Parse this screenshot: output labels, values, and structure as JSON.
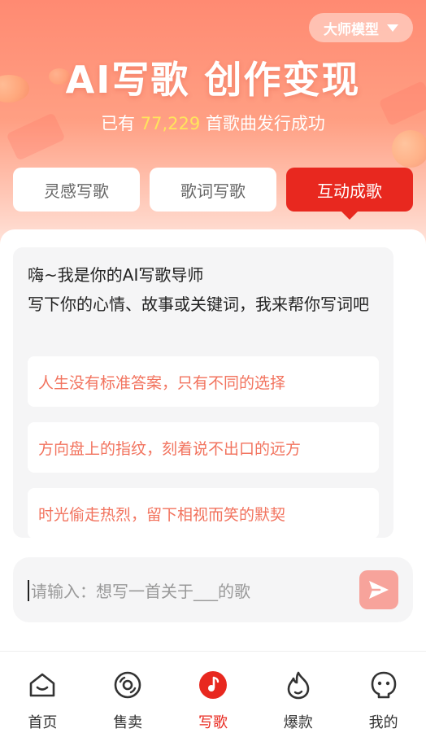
{
  "header": {
    "model_selector": "大师模型",
    "title": "AI写歌 创作变现",
    "subtitle_prefix": "已有",
    "subtitle_count": "77,229",
    "subtitle_suffix": "首歌曲发行成功"
  },
  "tabs": [
    {
      "label": "灵感写歌",
      "active": false
    },
    {
      "label": "歌词写歌",
      "active": false
    },
    {
      "label": "互动成歌",
      "active": true
    }
  ],
  "chat": {
    "greeting_line1": "嗨~我是你的AI写歌导师",
    "greeting_line2": "写下你的心情、故事或关键词，我来帮你写词吧",
    "suggestions": [
      "人生没有标准答案，只有不同的选择",
      "方向盘上的指纹，刻着说不出口的远方",
      "时光偷走热烈，留下相视而笑的默契"
    ]
  },
  "input": {
    "placeholder": "请输入：想写一首关于___的歌",
    "value": ""
  },
  "nav": [
    {
      "label": "首页",
      "icon": "home-icon",
      "active": false
    },
    {
      "label": "售卖",
      "icon": "vinyl-disc-icon",
      "active": false
    },
    {
      "label": "写歌",
      "icon": "music-note-icon",
      "active": true
    },
    {
      "label": "爆款",
      "icon": "flame-icon",
      "active": false
    },
    {
      "label": "我的",
      "icon": "profile-face-icon",
      "active": false
    }
  ],
  "colors": {
    "accent": "#e8281f",
    "suggestion_text": "#f2735e",
    "highlight_number": "#ffe45c",
    "send_button": "#f7a39b"
  }
}
